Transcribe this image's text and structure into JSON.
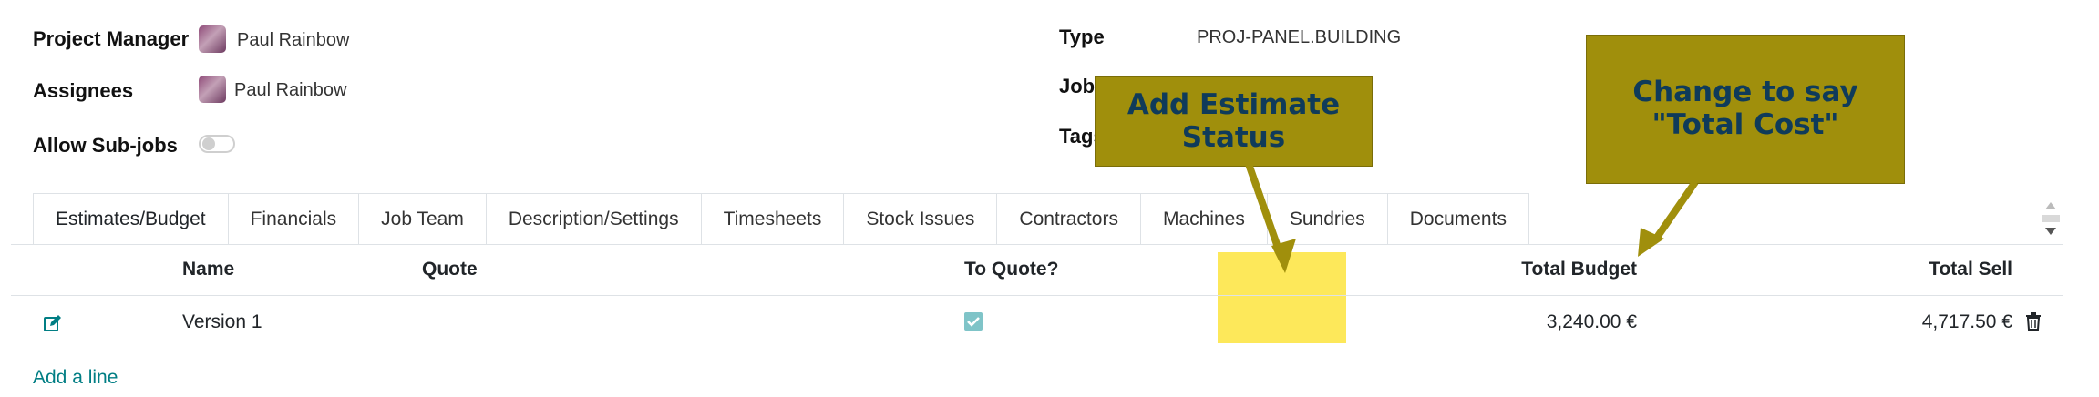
{
  "form": {
    "project_manager_label": "Project Manager",
    "project_manager_value": "Paul Rainbow",
    "assignees_label": "Assignees",
    "assignees_value": "Paul Rainbow",
    "allow_subjobs_label": "Allow Sub-jobs",
    "allow_subjobs_checked": false,
    "type_label": "Type",
    "type_value": "PROJ-PANEL.BUILDING",
    "job_label": "Job",
    "tags_label": "Tags"
  },
  "tabs": [
    {
      "label": "Estimates/Budget",
      "active": true
    },
    {
      "label": "Financials"
    },
    {
      "label": "Job Team"
    },
    {
      "label": "Description/Settings"
    },
    {
      "label": "Timesheets"
    },
    {
      "label": "Stock Issues"
    },
    {
      "label": "Contractors"
    },
    {
      "label": "Machines"
    },
    {
      "label": "Sundries"
    },
    {
      "label": "Documents"
    }
  ],
  "table": {
    "columns": {
      "name": "Name",
      "quote": "Quote",
      "to_quote": "To Quote?",
      "total_budget": "Total Budget",
      "total_sell": "Total Sell"
    },
    "rows": [
      {
        "name": "Version 1",
        "quote": "",
        "to_quote": true,
        "total_budget": "3,240.00 €",
        "total_sell": "4,717.50 €"
      }
    ],
    "add_line": "Add a line"
  },
  "annotations": {
    "callout1": "Add Estimate Status",
    "callout2": "Change to say \"Total Cost\""
  },
  "colors": {
    "callout_fill": "#a08f0c",
    "callout_text": "#0f3b5a",
    "highlight": "#fde85a",
    "link": "#017e84"
  }
}
